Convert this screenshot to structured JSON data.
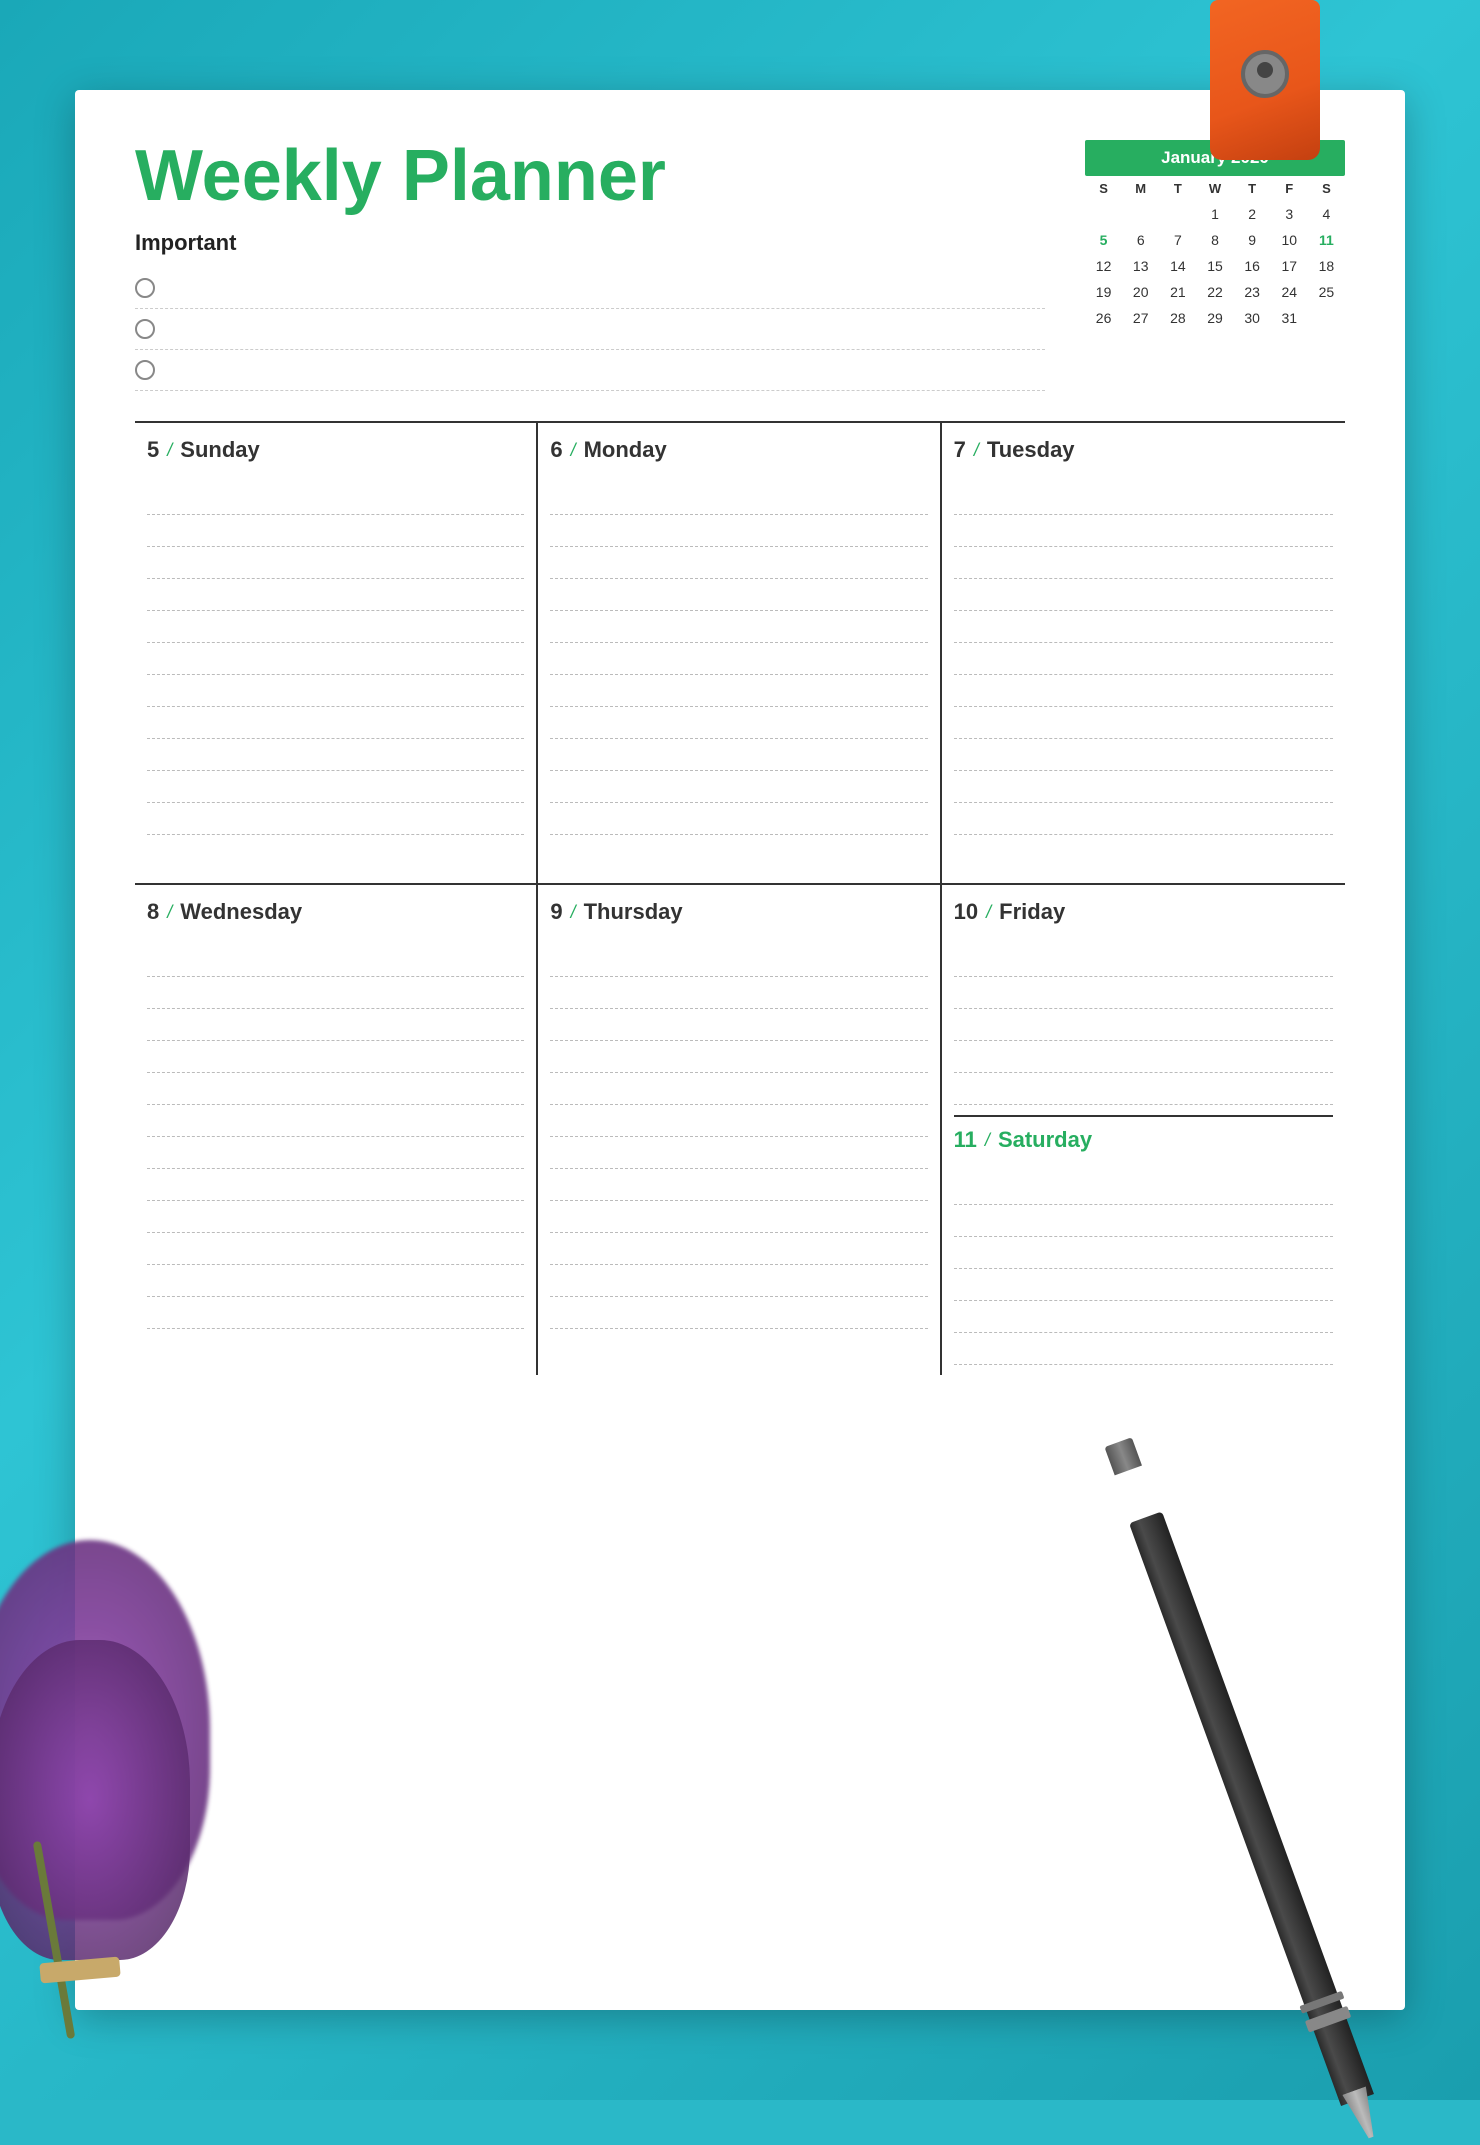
{
  "background": {
    "color": "#2ab8c8"
  },
  "title": "Weekly Planner",
  "important": {
    "label": "Important",
    "items": [
      "",
      "",
      ""
    ]
  },
  "calendar": {
    "month_year": "January 2020",
    "day_headers": [
      "S",
      "M",
      "T",
      "W",
      "T",
      "F",
      "S"
    ],
    "weeks": [
      [
        "",
        "",
        "",
        "1",
        "2",
        "3",
        "4"
      ],
      [
        "5",
        "6",
        "7",
        "8",
        "9",
        "10",
        "11"
      ],
      [
        "12",
        "13",
        "14",
        "15",
        "16",
        "17",
        "18"
      ],
      [
        "19",
        "20",
        "21",
        "22",
        "23",
        "24",
        "25"
      ],
      [
        "26",
        "27",
        "28",
        "29",
        "30",
        "31",
        ""
      ]
    ]
  },
  "days": [
    {
      "num": "5",
      "slash": "/",
      "name": "Sunday",
      "green": false
    },
    {
      "num": "6",
      "slash": "/",
      "name": "Monday",
      "green": false
    },
    {
      "num": "7",
      "slash": "/",
      "name": "Tuesday",
      "green": false
    },
    {
      "num": "8",
      "slash": "/",
      "name": "Wednesday",
      "green": false
    },
    {
      "num": "9",
      "slash": "/",
      "name": "Thursday",
      "green": false
    },
    {
      "num": "10",
      "slash": "/",
      "name": "Friday",
      "green": false
    },
    {
      "num": "11",
      "slash": "/",
      "name": "Saturday",
      "green": true
    }
  ],
  "lines_per_day": 12
}
